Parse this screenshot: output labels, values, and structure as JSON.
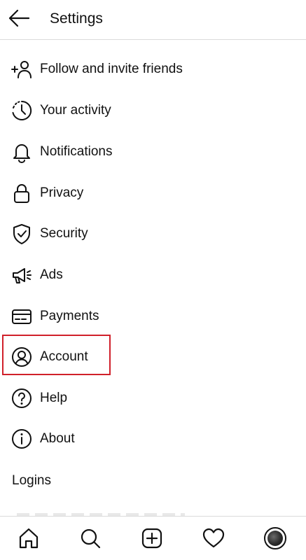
{
  "header": {
    "title": "Settings",
    "back_icon": "arrow-left-icon"
  },
  "menu": [
    {
      "label": "Follow and invite friends",
      "icon": "add-person-icon"
    },
    {
      "label": "Your activity",
      "icon": "activity-clock-icon"
    },
    {
      "label": "Notifications",
      "icon": "bell-icon"
    },
    {
      "label": "Privacy",
      "icon": "lock-icon"
    },
    {
      "label": "Security",
      "icon": "shield-check-icon"
    },
    {
      "label": "Ads",
      "icon": "megaphone-icon"
    },
    {
      "label": "Payments",
      "icon": "card-icon"
    },
    {
      "label": "Account",
      "icon": "user-circle-icon"
    },
    {
      "label": "Help",
      "icon": "question-circle-icon"
    },
    {
      "label": "About",
      "icon": "info-circle-icon"
    }
  ],
  "logins": {
    "label": "Logins"
  },
  "highlight": {
    "color": "#d0202a",
    "target": "Account"
  },
  "bottom_nav": [
    "home-icon",
    "search-icon",
    "new-post-icon",
    "heart-icon",
    "profile-avatar"
  ]
}
